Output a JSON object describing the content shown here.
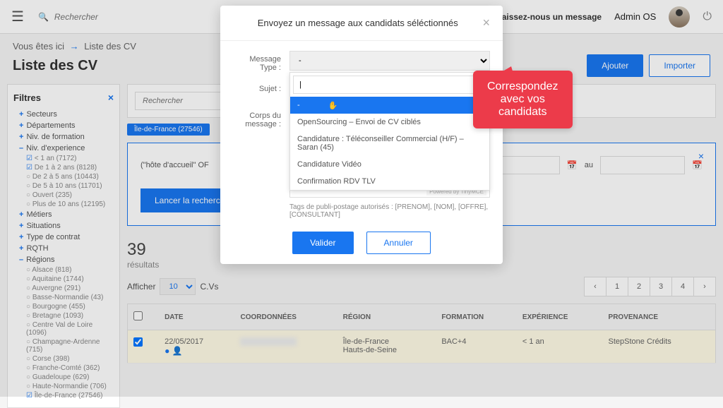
{
  "topbar": {
    "search_placeholder": "Rechercher",
    "leave_message": "Laissez-nous un message",
    "username": "Admin OS"
  },
  "breadcrumb": {
    "prefix": "Vous êtes ici",
    "arrow": "→",
    "current": "Liste des CV"
  },
  "page": {
    "title": "Liste des CV",
    "add_btn": "Ajouter",
    "import_btn": "Importer"
  },
  "filters": {
    "heading": "Filtres",
    "items": [
      {
        "label": "Secteurs"
      },
      {
        "label": "Départements"
      },
      {
        "label": "Niv. de formation"
      },
      {
        "label": "Niv. d'experience",
        "open": true,
        "subs": [
          {
            "label": "< 1 an (7172)",
            "check": true
          },
          {
            "label": "De 1 à 2 ans (8128)",
            "check": true
          },
          {
            "label": "De 2 à 5 ans (10443)"
          },
          {
            "label": "De 5 à 10 ans (11701)"
          },
          {
            "label": "Ouvert (235)"
          },
          {
            "label": "Plus de 10 ans (12195)"
          }
        ]
      },
      {
        "label": "Métiers"
      },
      {
        "label": "Situations"
      },
      {
        "label": "Type de contrat"
      },
      {
        "label": "RQTH"
      },
      {
        "label": "Régions",
        "open": true,
        "subs": [
          {
            "label": "Alsace (818)"
          },
          {
            "label": "Aquitaine (1744)"
          },
          {
            "label": "Auvergne (291)"
          },
          {
            "label": "Basse-Normandie (43)"
          },
          {
            "label": "Bourgogne (455)"
          },
          {
            "label": "Bretagne (1093)"
          },
          {
            "label": "Centre Val de Loire (1096)"
          },
          {
            "label": "Champagne-Ardenne (715)"
          },
          {
            "label": "Corse (398)"
          },
          {
            "label": "Franche-Comté (362)"
          },
          {
            "label": "Guadeloupe (629)"
          },
          {
            "label": "Haute-Normandie (706)"
          },
          {
            "label": "Île-de-France (27546)",
            "check": true
          }
        ]
      }
    ]
  },
  "toolbar": {
    "search_placeholder": "Rechercher",
    "chip": "Île-de-France (27546)"
  },
  "filter_box": {
    "text": "(\"hôte d'accueil\" OF",
    "au": "au",
    "launch": "Lancer la recherc"
  },
  "results": {
    "count": "39",
    "label": "résultats",
    "display_prefix": "Afficher",
    "display_value": "10",
    "display_suffix": "C.Vs"
  },
  "pagination": [
    "‹",
    "1",
    "2",
    "3",
    "4",
    "›"
  ],
  "table": {
    "cols": [
      "",
      "DATE",
      "COORDONNÉES",
      "RÉGION",
      "FORMATION",
      "EXPÉRIENCE",
      "PROVENANCE"
    ],
    "rows": [
      {
        "date": "22/05/2017",
        "region1": "Île-de-France",
        "region2": "Hauts-de-Seine",
        "formation": "BAC+4",
        "exp": "< 1 an",
        "prov": "StepStone Crédits"
      }
    ]
  },
  "modal": {
    "title": "Envoyez un message aux candidats séléctionnés",
    "label_type": "Message Type :",
    "label_subject": "Sujet :",
    "label_body": "Corps du message :",
    "type_value": "-",
    "dropdown": [
      {
        "label": "-",
        "hover": true
      },
      {
        "label": "OpenSourcing – Envoi de CV ciblés"
      },
      {
        "label": "Candidature : Téléconseiller Commercial (H/F) – Saran (45)"
      },
      {
        "label": "Candidature Vidéo"
      },
      {
        "label": "Confirmation RDV TLV"
      }
    ],
    "rte_brand": "Powered by TinyMCE",
    "tags_note": "Tags de publi-postage autorisés : [PRENOM], [NOM], [OFFRE], [CONSULTANT]",
    "ok": "Valider",
    "cancel": "Annuler"
  },
  "callout": {
    "line1": "Correspondez",
    "line2": "avec vos",
    "line3": "candidats"
  }
}
